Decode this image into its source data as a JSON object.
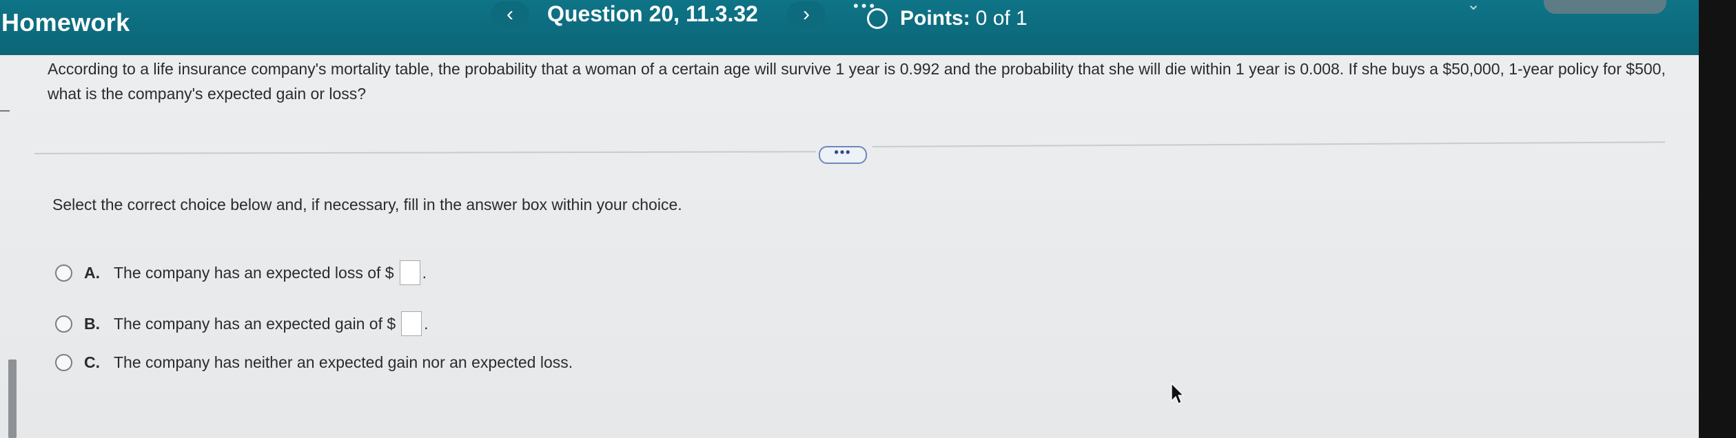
{
  "header": {
    "title": "Homework",
    "question_label": "Question 20, 11.3.32",
    "points_label": "Points:",
    "points_value": "0 of 1",
    "prev_icon": "chevron-left-icon",
    "next_icon": "chevron-right-icon",
    "accent_color": "#0f7487"
  },
  "question": {
    "text": "According to a life insurance company's mortality table, the probability that a woman of a certain age will survive 1 year is 0.992 and the probability that she will die within 1 year is 0.008. If she buys a $50,000, 1-year policy for $500, what is the company's expected gain or loss?"
  },
  "more_button": {
    "label": "•••"
  },
  "instructions": "Select the correct choice below and, if necessary, fill in the answer box within your choice.",
  "choices": [
    {
      "letter": "A.",
      "text": "The company has an expected loss of $",
      "has_input": true,
      "input_value": "",
      "suffix": "."
    },
    {
      "letter": "B.",
      "text": "The company has an expected gain of $",
      "has_input": true,
      "input_value": "",
      "suffix": "."
    },
    {
      "letter": "C.",
      "text": "The company has neither an expected gain nor an expected loss.",
      "has_input": false
    }
  ]
}
